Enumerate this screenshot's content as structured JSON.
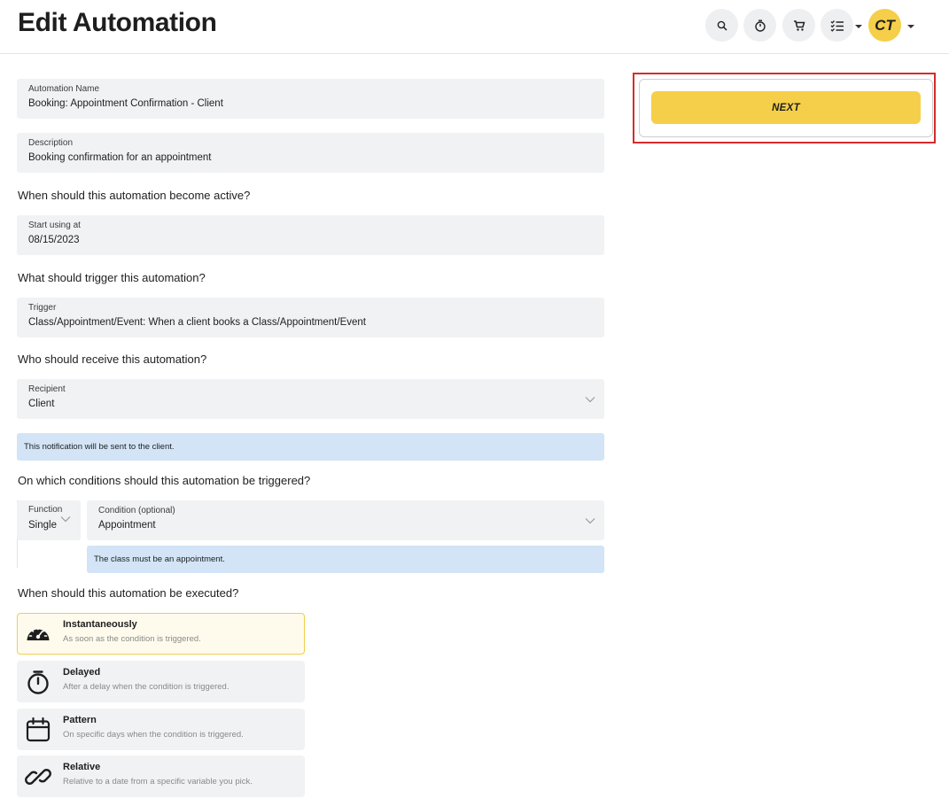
{
  "header": {
    "title": "Edit Automation",
    "avatar_initials": "CT",
    "icons": [
      "search-icon",
      "timer-icon",
      "cart-icon",
      "checklist-icon"
    ]
  },
  "form": {
    "automation_name": {
      "label": "Automation Name",
      "value": "Booking: Appointment Confirmation - Client"
    },
    "description": {
      "label": "Description",
      "value": "Booking confirmation for an appointment"
    },
    "q_active": "When should this automation become active?",
    "start": {
      "label": "Start using at",
      "value": "08/15/2023"
    },
    "q_trigger": "What should trigger this automation?",
    "trigger": {
      "label": "Trigger",
      "value": "Class/Appointment/Event: When a client books a Class/Appointment/Event"
    },
    "q_recipient": "Who should receive this automation?",
    "recipient": {
      "label": "Recipient",
      "value": "Client"
    },
    "recipient_info": "This notification will be sent to the client.",
    "q_conditions": "On which conditions should this automation be triggered?",
    "function": {
      "label": "Function",
      "value": "Single"
    },
    "condition": {
      "label": "Condition (optional)",
      "value": "Appointment"
    },
    "condition_info": "The class must be an appointment.",
    "q_executed": "When should this automation be executed?",
    "execution_options": [
      {
        "title": "Instantaneously",
        "desc": "As soon as the condition is triggered.",
        "icon": "speedometer-icon",
        "selected": true
      },
      {
        "title": "Delayed",
        "desc": "After a delay when the condition is triggered.",
        "icon": "stopwatch-icon",
        "selected": false
      },
      {
        "title": "Pattern",
        "desc": "On specific days when the condition is triggered.",
        "icon": "calendar-icon",
        "selected": false
      },
      {
        "title": "Relative",
        "desc": "Relative to a date from a specific variable you pick.",
        "icon": "link-icon",
        "selected": false
      }
    ]
  },
  "actions": {
    "next_label": "NEXT"
  },
  "colors": {
    "accent": "#f5cf49",
    "field_bg": "#f1f2f4",
    "info_bg": "#d2e4f6",
    "highlight": "#d62b2b"
  }
}
